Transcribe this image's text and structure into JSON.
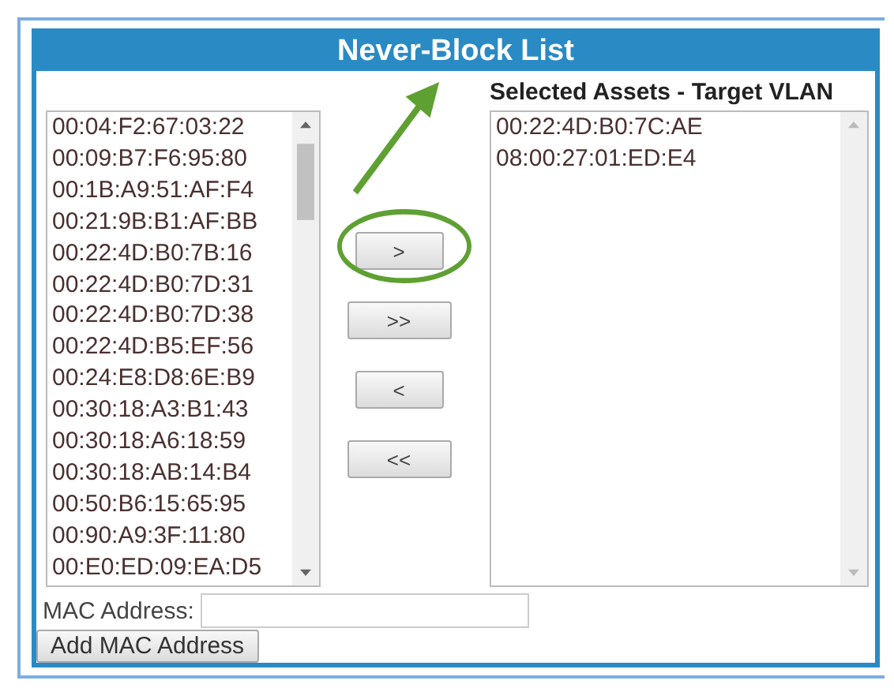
{
  "panel": {
    "title": "Never-Block List"
  },
  "available": {
    "items": [
      "00:04:F2:67:03:22",
      "00:09:B7:F6:95:80",
      "00:1B:A9:51:AF:F4",
      "00:21:9B:B1:AF:BB",
      "00:22:4D:B0:7B:16",
      "00:22:4D:B0:7D:31",
      "00:22:4D:B0:7D:38",
      "00:22:4D:B5:EF:56",
      "00:24:E8:D8:6E:B9",
      "00:30:18:A3:B1:43",
      "00:30:18:A6:18:59",
      "00:30:18:AB:14:B4",
      "00:50:B6:15:65:95",
      "00:90:A9:3F:11:80",
      "00:E0:ED:09:EA:D5"
    ]
  },
  "move_buttons": [
    ">",
    ">>",
    "<",
    "<<"
  ],
  "selected": {
    "heading": "Selected Assets - Target VLAN",
    "items": [
      "00:22:4D:B0:7C:AE",
      "08:00:27:01:ED:E4"
    ]
  },
  "mac_field": {
    "label": "MAC Address:"
  },
  "add_button": "Add MAC Address",
  "annotations": [
    {
      "kind": "arrow"
    },
    {
      "kind": "ellipse"
    }
  ]
}
